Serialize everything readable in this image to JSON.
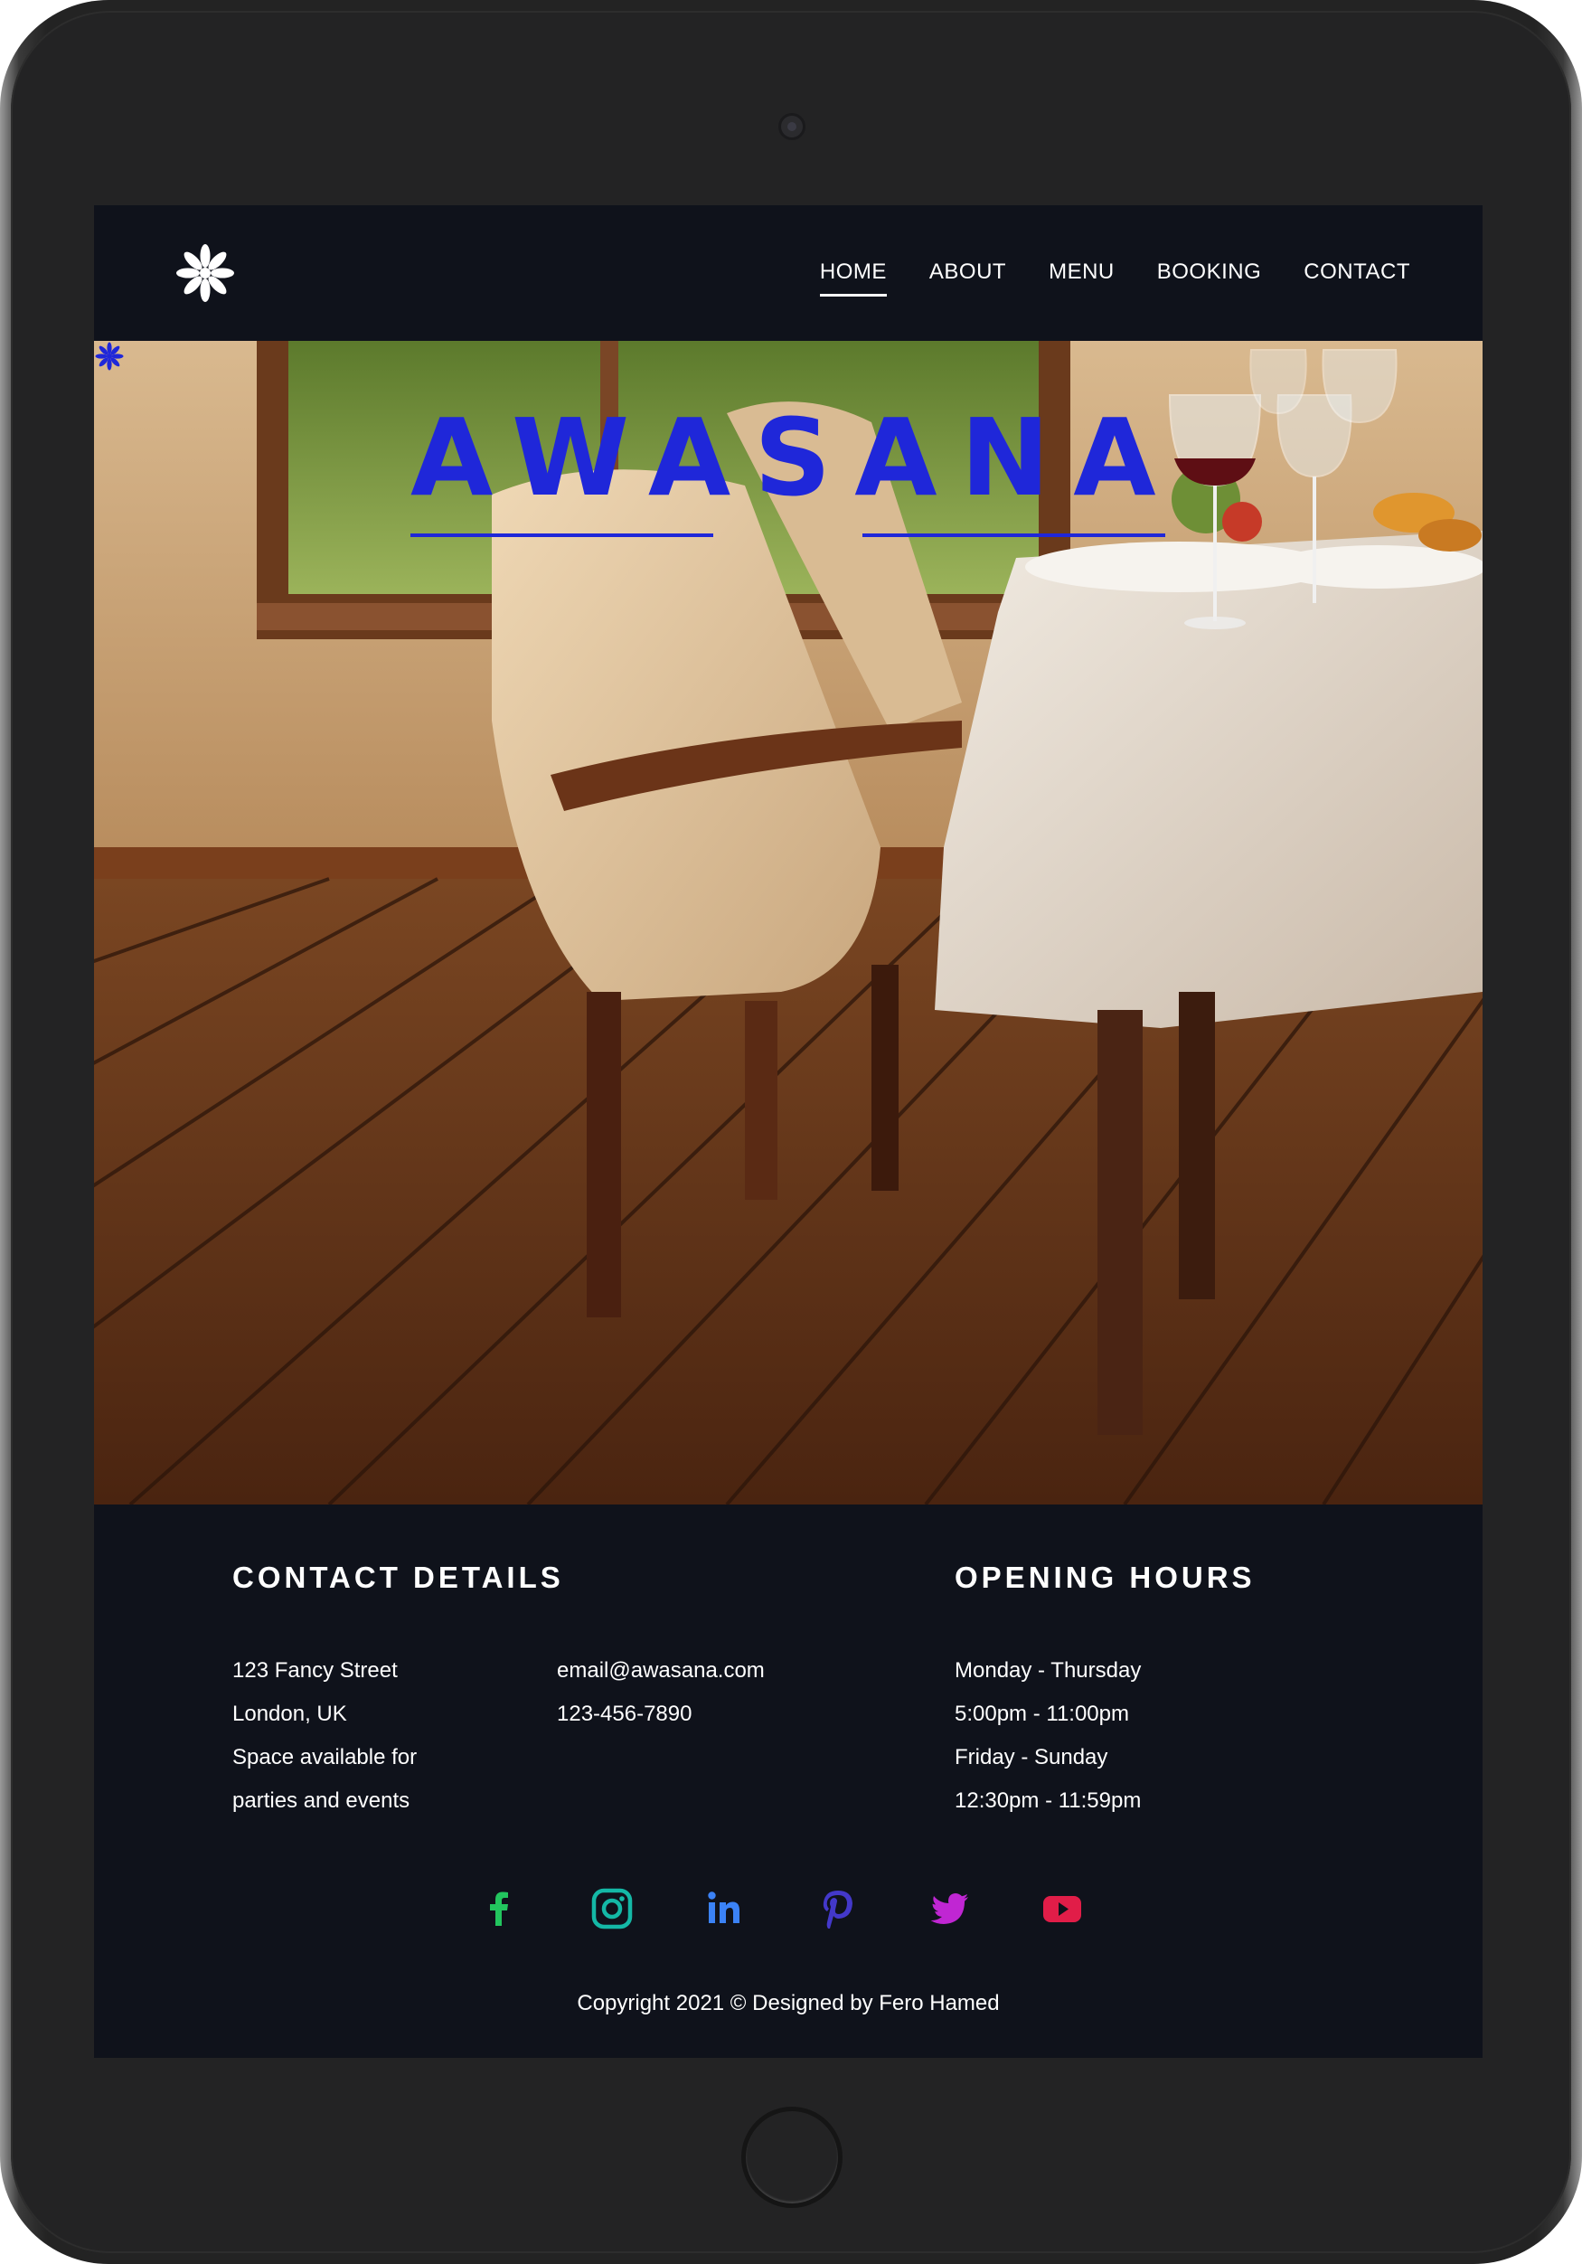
{
  "nav": {
    "items": [
      {
        "label": "HOME",
        "active": true
      },
      {
        "label": "ABOUT",
        "active": false
      },
      {
        "label": "MENU",
        "active": false
      },
      {
        "label": "BOOKING",
        "active": false
      },
      {
        "label": "CONTACT",
        "active": false
      }
    ]
  },
  "hero": {
    "title": "AWASANA",
    "image": "restaurant dining chair and set table with wine glasses on wooden floor"
  },
  "contact": {
    "title": "CONTACT DETAILS",
    "address": [
      "123 Fancy Street",
      "London, UK",
      "Space available for",
      "parties and events"
    ],
    "email": "email@awasana.com",
    "phone": "123-456-7890"
  },
  "hours": {
    "title": "OPENING HOURS",
    "lines": [
      "Monday - Thursday",
      "5:00pm - 11:00pm",
      "Friday - Sunday",
      "12:30pm - 11:59pm"
    ]
  },
  "socials": [
    {
      "icon": "facebook-icon",
      "color": "#22c55e"
    },
    {
      "icon": "instagram-icon",
      "color": "#14b8a6"
    },
    {
      "icon": "linkedin-icon",
      "color": "#3b82f6"
    },
    {
      "icon": "pinterest-icon",
      "color": "#4338ca"
    },
    {
      "icon": "twitter-icon",
      "color": "#c026d3"
    },
    {
      "icon": "youtube-icon",
      "color": "#e11d48"
    }
  ],
  "footer": {
    "copyright": "Copyright 2021 © Designed by Fero Hamed"
  },
  "colors": {
    "accent": "#1f27d9",
    "background": "#0f121b"
  }
}
